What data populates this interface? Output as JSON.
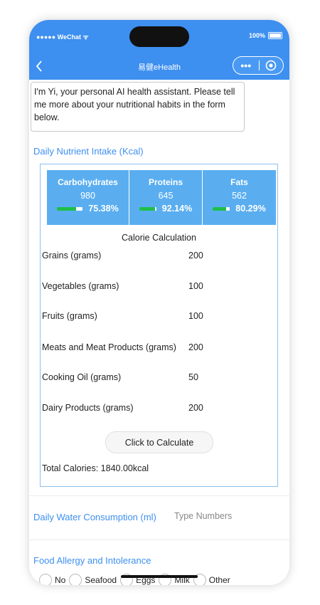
{
  "status": {
    "carrier": "●●●●● WeChat",
    "wifi": "ᯤ",
    "battery": "100%"
  },
  "nav": {
    "back": "‹",
    "title": "易健eHealth",
    "more": "•••"
  },
  "assistant_message": "I'm Yi, your personal AI health assistant. Please tell me more about your nutritional habits in the form below.",
  "nutrient_section_title": "Daily Nutrient Intake (Kcal)",
  "nutrients": [
    {
      "name": "Carbohydrates",
      "value": "980",
      "percent": "75.38%",
      "fill": 0.75
    },
    {
      "name": "Proteins",
      "value": "645",
      "percent": "92.14%",
      "fill": 0.92
    },
    {
      "name": "Fats",
      "value": "562",
      "percent": "80.29%",
      "fill": 0.8
    }
  ],
  "calc_title": "Calorie Calculation",
  "foods": [
    {
      "label": "Grains (grams)",
      "value": "200"
    },
    {
      "label": "Vegetables (grams)",
      "value": "100"
    },
    {
      "label": "Fruits (grams)",
      "value": "100"
    },
    {
      "label": "Meats and Meat Products (grams)",
      "value": "200"
    },
    {
      "label": "Cooking Oil (grams)",
      "value": "50"
    },
    {
      "label": "Dairy Products (grams)",
      "value": "200"
    }
  ],
  "calc_button": "Click to Calculate",
  "total_calories": "Total Calories: 1840.00kcal",
  "water": {
    "label": "Daily Water Consumption (ml)",
    "placeholder": "Type Numbers"
  },
  "allergy": {
    "title": "Food Allergy and Intolerance",
    "options": [
      "No",
      "Seafood",
      "Eggs",
      "Milk",
      "Other"
    ]
  },
  "colors": {
    "primary": "#3d8ff0",
    "nutrient_bg": "#5aaef0",
    "progress": "#1fbf4a"
  }
}
